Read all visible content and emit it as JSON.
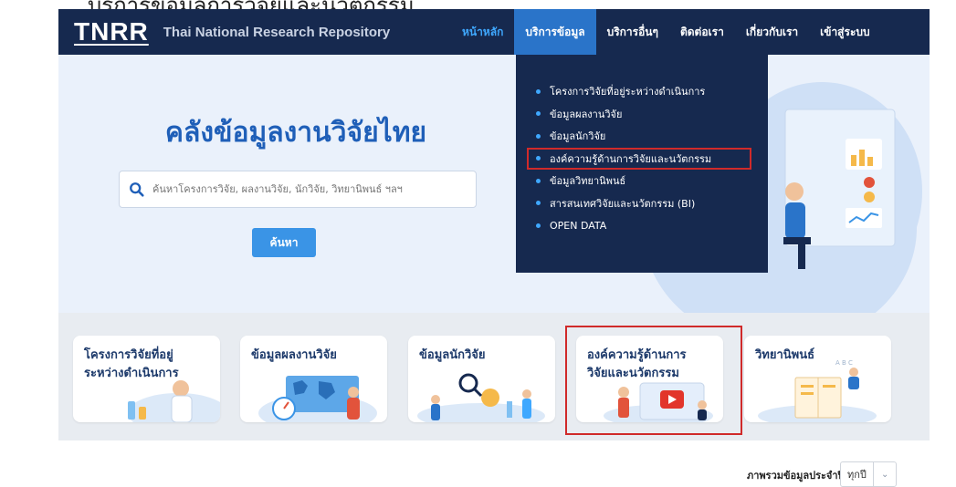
{
  "caption": "บริการข้อมูลการวิจัยและนวัตกรรม",
  "navbar": {
    "logo": "TNRR",
    "subtitle": "Thai National Research Repository",
    "items": [
      {
        "label": "หน้าหลัก"
      },
      {
        "label": "บริการข้อมูล"
      },
      {
        "label": "บริการอื่นๆ"
      },
      {
        "label": "ติดต่อเรา"
      },
      {
        "label": "เกี่ยวกับเรา"
      },
      {
        "label": "เข้าสู่ระบบ"
      }
    ]
  },
  "hero": {
    "title": "คลังข้อมูลงานวิจัยไทย",
    "search_placeholder": "ค้นหาโครงการวิจัย, ผลงานวิจัย, นักวิจัย, วิทยานิพนธ์ ฯลฯ",
    "search_button": "ค้นหา"
  },
  "dropdown": {
    "items": [
      {
        "label": "โครงการวิจัยที่อยู่ระหว่างดำเนินการ"
      },
      {
        "label": "ข้อมูลผลงานวิจัย"
      },
      {
        "label": "ข้อมูลนักวิจัย"
      },
      {
        "label": "องค์ความรู้ด้านการวิจัยและนวัตกรรม"
      },
      {
        "label": "ข้อมูลวิทยานิพนธ์"
      },
      {
        "label": "สารสนเทศวิจัยและนวัตกรรม (BI)"
      },
      {
        "label": "OPEN DATA"
      }
    ]
  },
  "cards": [
    {
      "line1": "โครงการวิจัยที่อยู่",
      "line2": "ระหว่างดำเนินการ"
    },
    {
      "line1": "ข้อมูลผลงานวิจัย",
      "line2": ""
    },
    {
      "line1": "ข้อมูลนักวิจัย",
      "line2": ""
    },
    {
      "line1": "องค์ความรู้ด้านการ",
      "line2": "วิจัยและนวัตกรรม"
    },
    {
      "line1": "วิทยานิพนธ์",
      "line2": ""
    }
  ],
  "overview": {
    "label": "ภาพรวมข้อมูลประจำปี",
    "year_value": "ทุกปี"
  },
  "colors": {
    "navy": "#16294f",
    "accent": "#2a74c9",
    "highlight": "#d02a2a",
    "title_blue": "#1f5fb8"
  }
}
